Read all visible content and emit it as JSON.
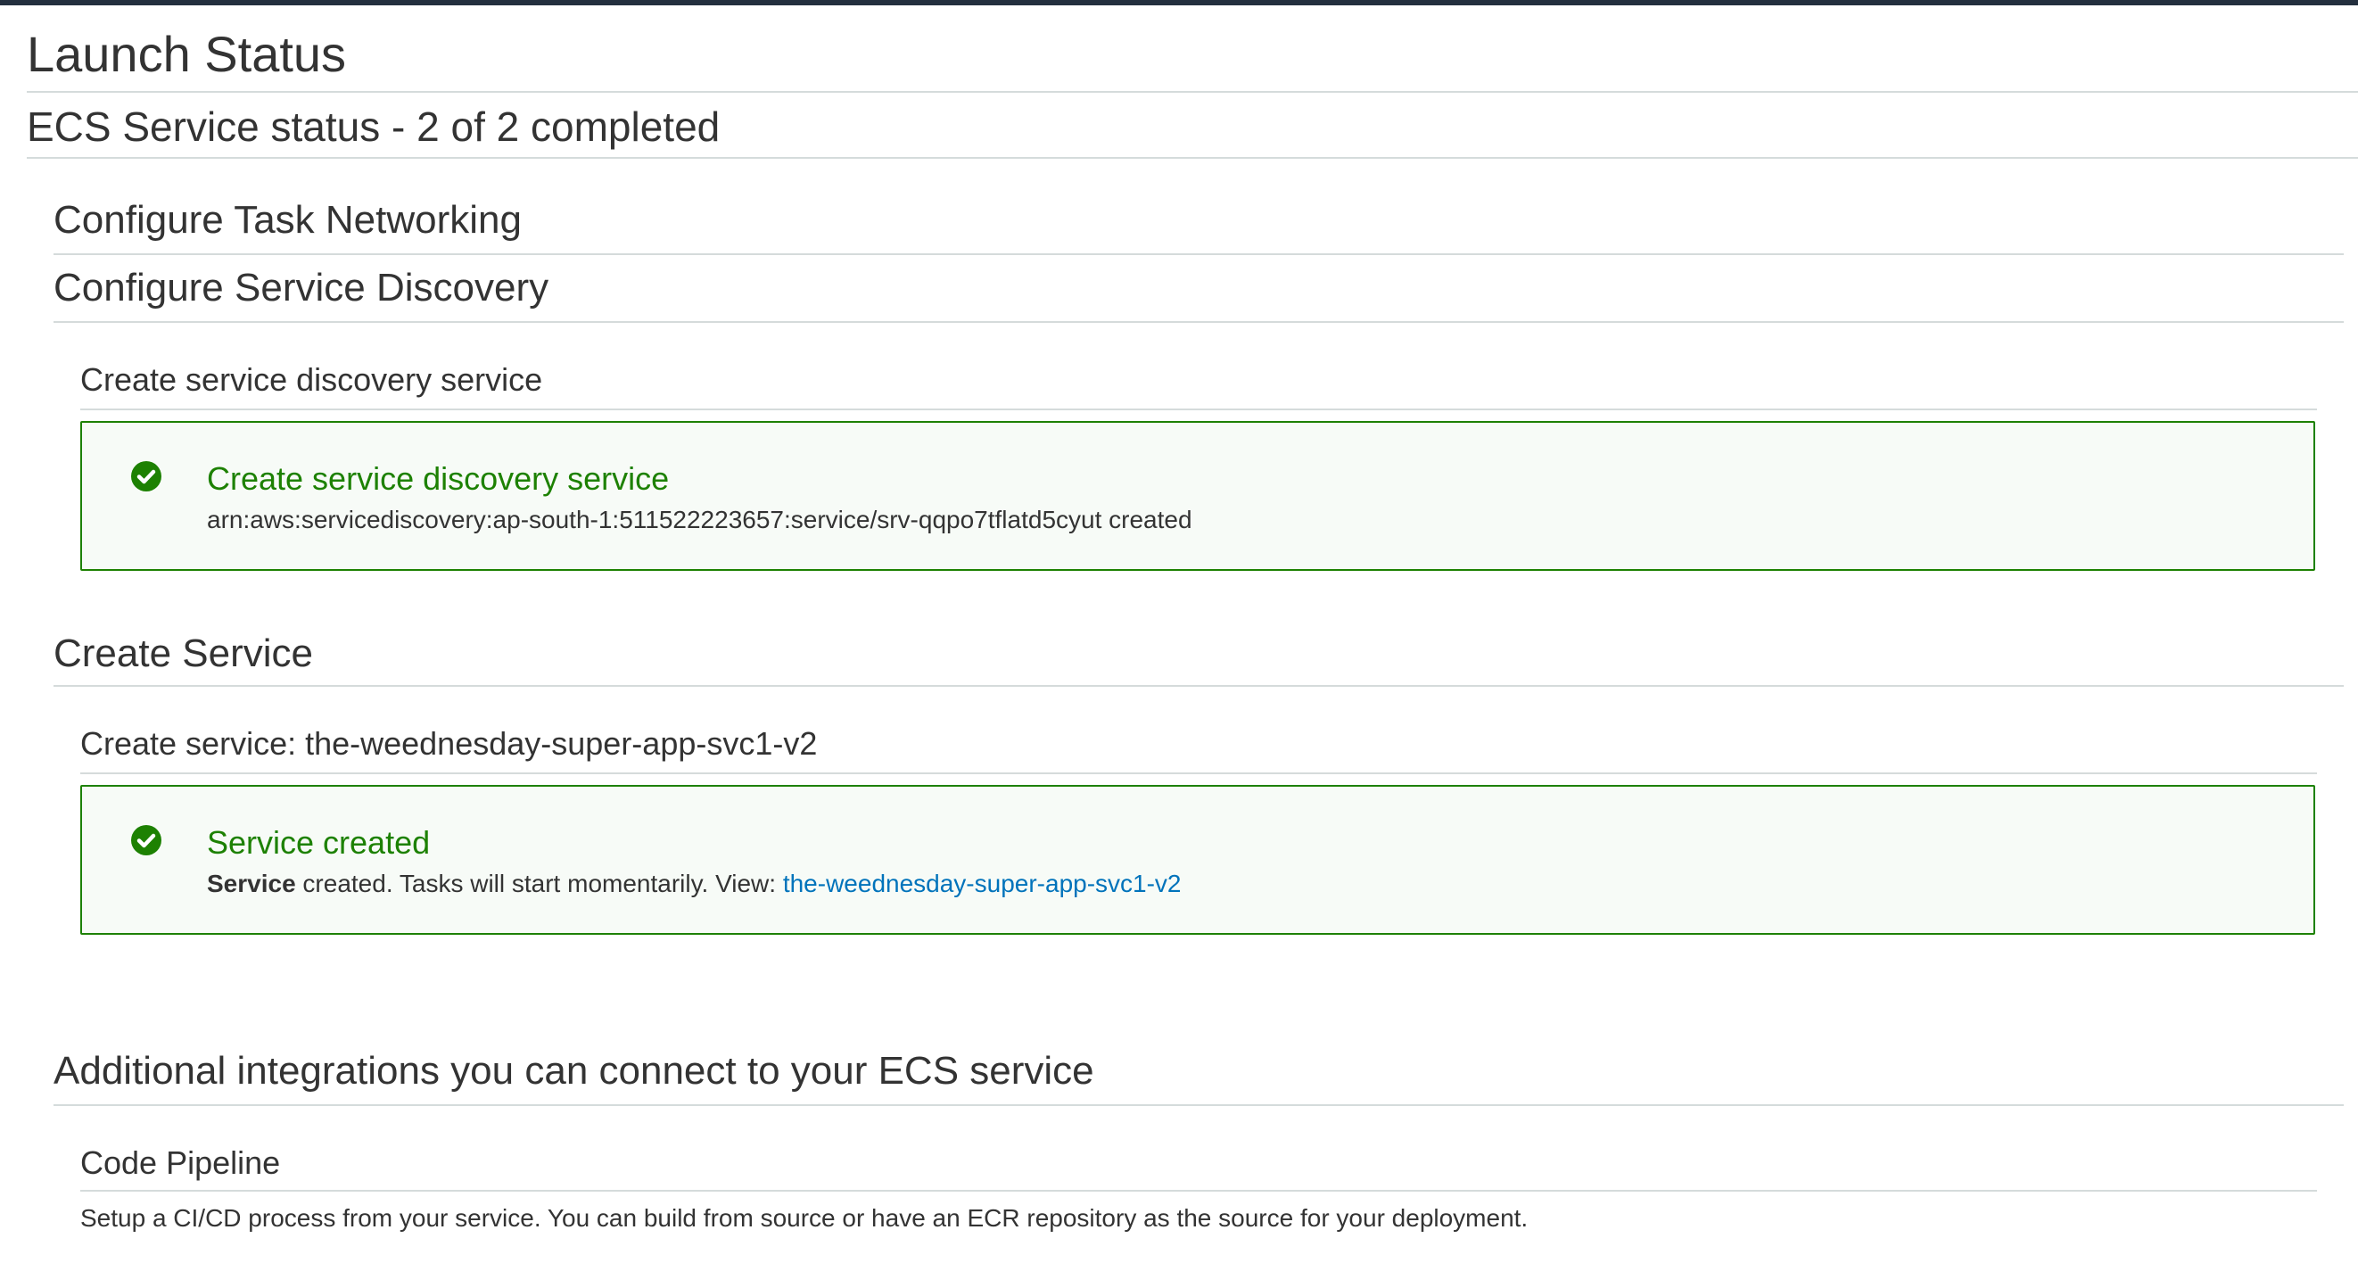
{
  "page": {
    "title": "Launch Status",
    "status": "ECS Service status - 2 of 2 completed"
  },
  "sections": {
    "task_networking": {
      "title": "Configure Task Networking"
    },
    "service_discovery": {
      "title": "Configure Service Discovery",
      "step_title": "Create service discovery service",
      "alert": {
        "icon": "check-circle-icon",
        "title": "Create service discovery service",
        "message": "arn:aws:servicediscovery:ap-south-1:511522223657:service/srv-qqpo7tflatd5cyut created"
      }
    },
    "create_service": {
      "title": "Create Service",
      "step_title": "Create service: the-weednesday-super-app-svc1-v2",
      "alert": {
        "icon": "check-circle-icon",
        "title": "Service created",
        "message_bold": "Service",
        "message_text": " created. Tasks will start momentarily. View: ",
        "link_text": "the-weednesday-super-app-svc1-v2"
      }
    },
    "integrations": {
      "title": "Additional integrations you can connect to your ECS service",
      "code_pipeline": {
        "title": "Code Pipeline",
        "description": "Setup a CI/CD process from your service. You can build from source or have an ECR repository as the source for your deployment."
      }
    }
  },
  "colors": {
    "success": "#1d8102",
    "success_bg": "#f7fbf7",
    "link": "#0073bb",
    "rule": "#d5dbdb",
    "topbar": "#232f3e"
  }
}
